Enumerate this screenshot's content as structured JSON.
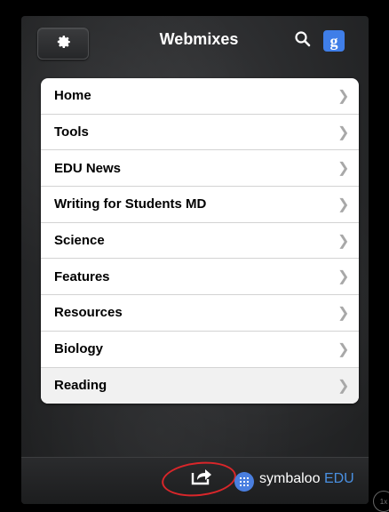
{
  "header": {
    "title": "Webmixes",
    "settings_icon": "gear-icon",
    "search_icon": "search-icon",
    "google_icon": "google-icon",
    "google_glyph": "g"
  },
  "webmixes": [
    {
      "label": "Home"
    },
    {
      "label": "Tools"
    },
    {
      "label": "EDU News"
    },
    {
      "label": "Writing for Students MD"
    },
    {
      "label": "Science"
    },
    {
      "label": "Features"
    },
    {
      "label": "Resources"
    },
    {
      "label": "Biology"
    },
    {
      "label": "Reading"
    }
  ],
  "footer": {
    "share_icon": "share-icon",
    "brand_name": "symbaloo",
    "brand_suffix": "EDU"
  },
  "corner_badge": "1x",
  "colors": {
    "brand_blue": "#4a90e2",
    "google_blue": "#3f7ee8",
    "highlight_red": "#d9262a"
  }
}
